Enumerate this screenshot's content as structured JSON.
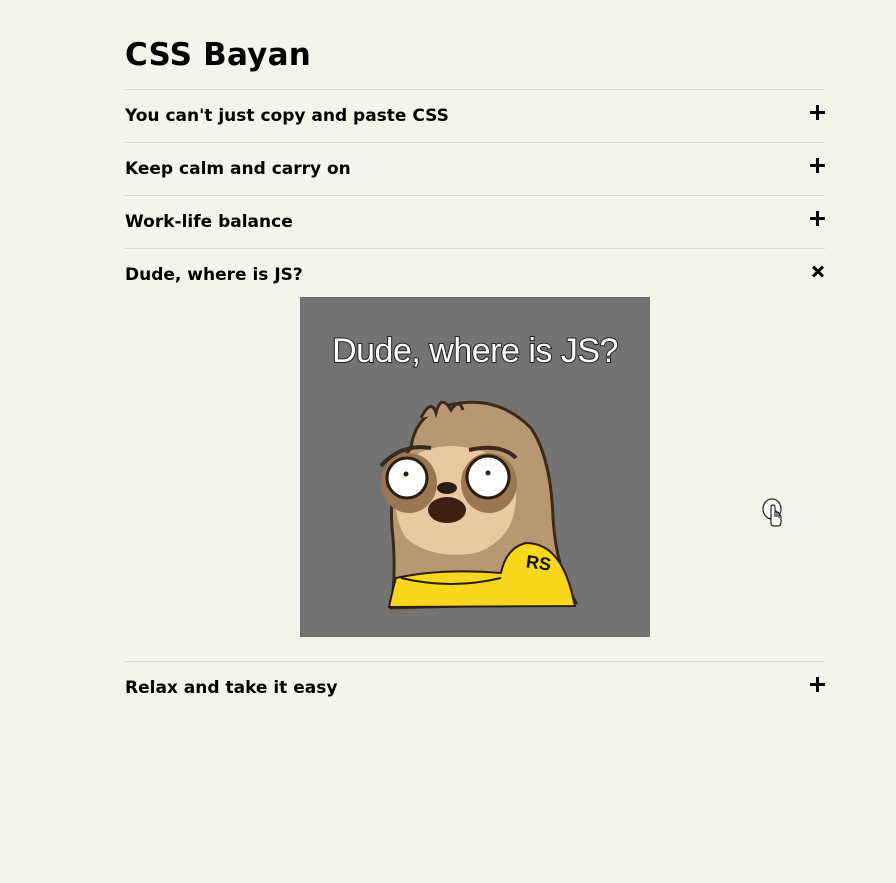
{
  "page": {
    "title": "CSS Bayan"
  },
  "accordion": {
    "items": [
      {
        "title": "You can't just copy and paste CSS",
        "state": "collapsed",
        "icon": "plus-icon"
      },
      {
        "title": "Keep calm and carry on",
        "state": "collapsed",
        "icon": "plus-icon"
      },
      {
        "title": "Work-life balance",
        "state": "collapsed",
        "icon": "plus-icon"
      },
      {
        "title": "Dude, where is JS?",
        "state": "expanded",
        "icon": "close-icon",
        "image": {
          "caption": "Dude, where is JS?",
          "badge": "RS"
        }
      },
      {
        "title": "Relax and take it easy",
        "state": "collapsed",
        "icon": "plus-icon"
      }
    ]
  },
  "colors": {
    "background": "#f4f3ec",
    "divider": "#d9d8d0",
    "image_background": "#737373",
    "shirt": "#f9d71c"
  }
}
